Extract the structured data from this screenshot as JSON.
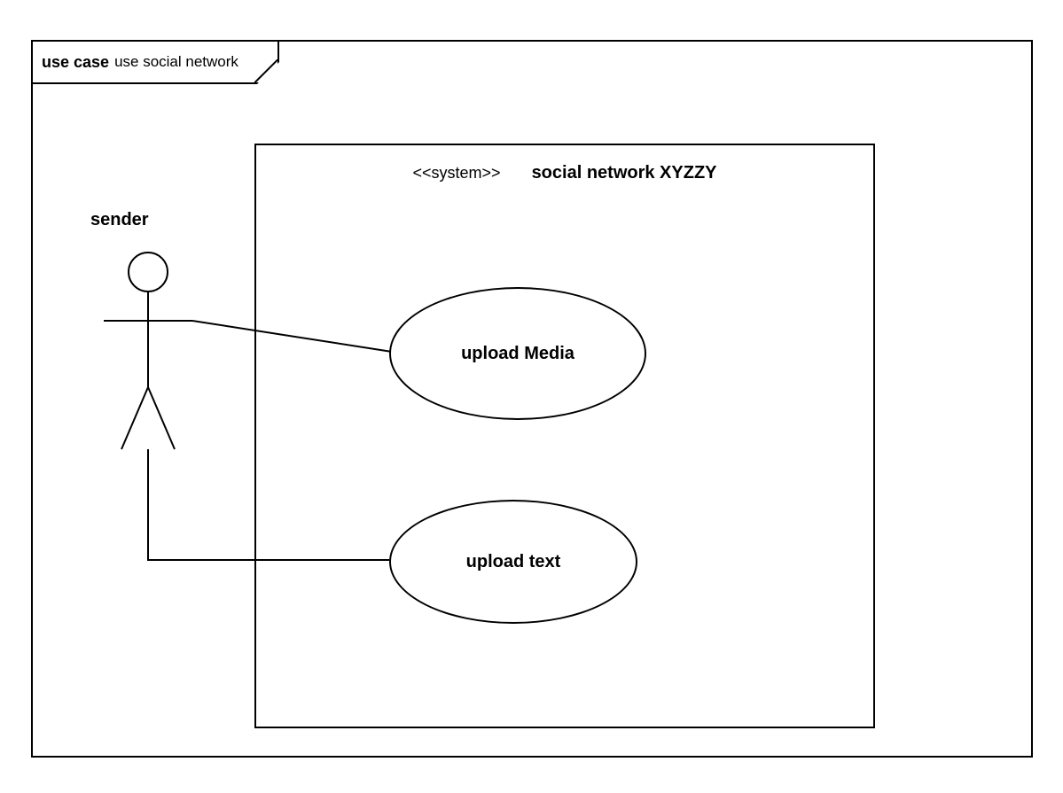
{
  "diagram": {
    "title_prefix": "use case",
    "title_name": "use social network",
    "actor": {
      "label": "sender"
    },
    "system": {
      "stereotype": "<<system>>",
      "name": "social network XYZZY"
    },
    "use_cases": [
      {
        "label": "upload Media"
      },
      {
        "label": "upload text"
      }
    ]
  }
}
